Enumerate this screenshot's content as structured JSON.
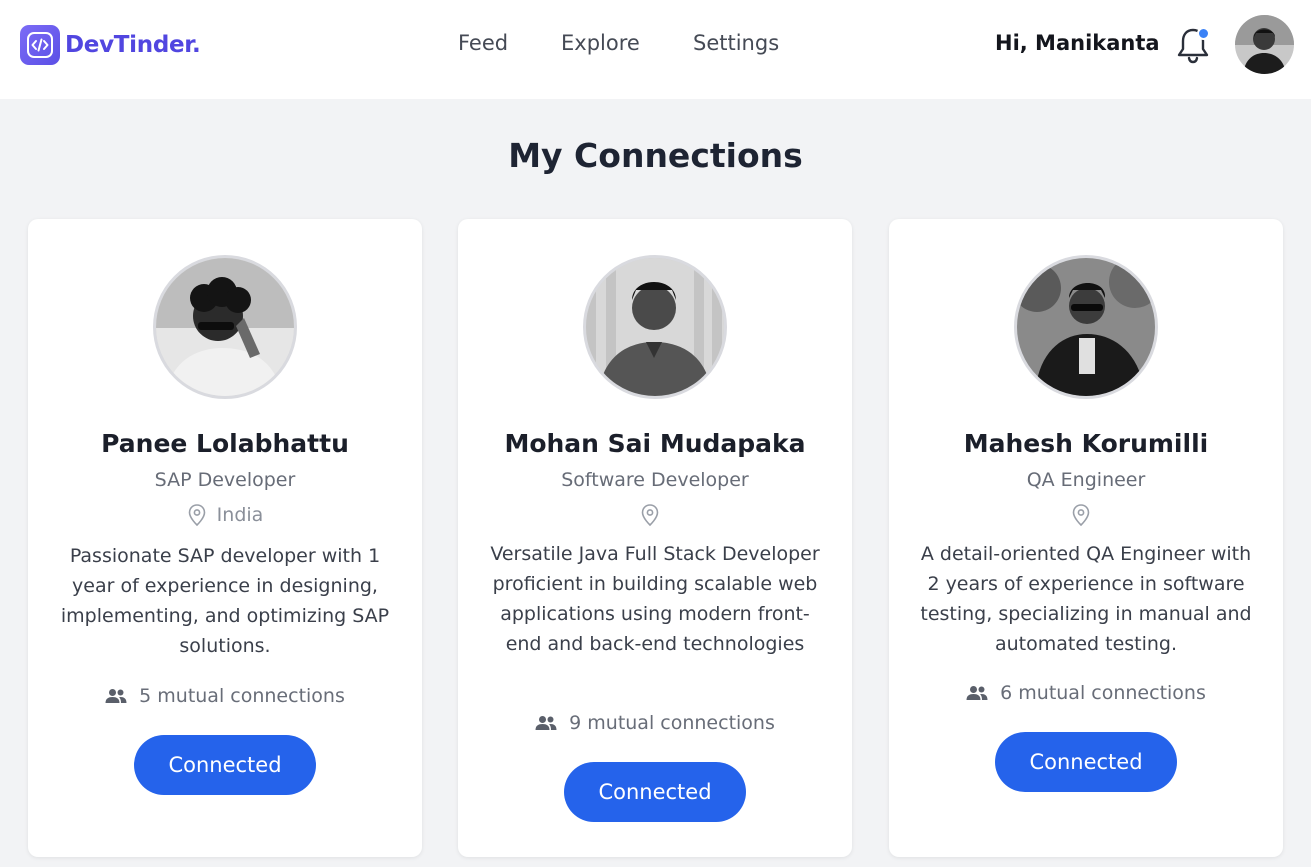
{
  "app": {
    "name": "DevTinder."
  },
  "nav": {
    "feed": "Feed",
    "explore": "Explore",
    "settings": "Settings"
  },
  "user": {
    "greeting": "Hi, Manikanta"
  },
  "page": {
    "title": "My Connections"
  },
  "connections": [
    {
      "name": "Panee Lolabhattu",
      "role": "SAP Developer",
      "location": "India",
      "bio": "Passionate SAP developer with 1 year of experience in designing, implementing, and optimizing SAP solutions.",
      "mutual": "5 mutual connections",
      "button": "Connected"
    },
    {
      "name": "Mohan Sai Mudapaka",
      "role": "Software Developer",
      "location": "",
      "bio": "Versatile Java Full Stack Developer proficient in building scalable web applications using modern front-end and back-end technologies",
      "mutual": "9 mutual connections",
      "button": "Connected"
    },
    {
      "name": "Mahesh Korumilli",
      "role": "QA Engineer",
      "location": "",
      "bio": "A detail-oriented QA Engineer with 2 years of experience in software testing, specializing in manual and automated testing.",
      "mutual": "6 mutual connections",
      "button": "Connected"
    }
  ],
  "colors": {
    "brand": "#5146e0",
    "button": "#2563eb",
    "notification_dot": "#3b82f6",
    "background": "#f2f3f5"
  },
  "icons": {
    "logo": "code-icon",
    "notifications": "bell-icon",
    "location": "map-pin-icon",
    "mutual": "users-icon"
  }
}
